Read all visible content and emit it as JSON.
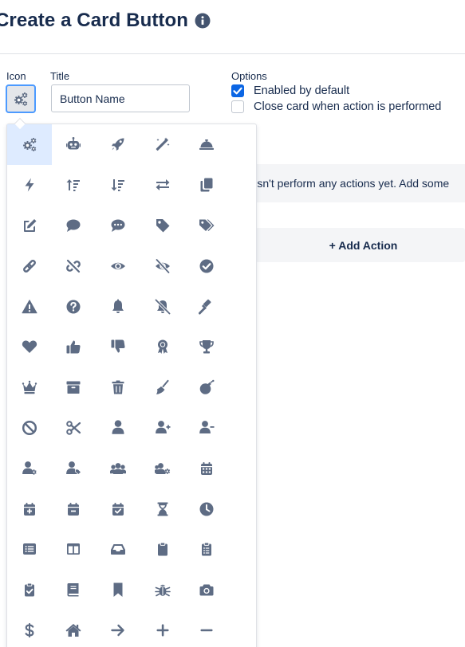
{
  "header": {
    "title": "Create a Card Button",
    "info_icon": "info-circle-icon"
  },
  "form": {
    "icon_label": "Icon",
    "title_label": "Title",
    "title_value": "Button Name",
    "options_label": "Options",
    "options": [
      {
        "label": "Enabled by default",
        "checked": true
      },
      {
        "label": "Close card when action is performed",
        "checked": false
      }
    ]
  },
  "actions": {
    "empty_text": "doesn't perform any actions yet. Add some",
    "add_label": "+ Add Action"
  },
  "icon_picker": {
    "selected": "cogs",
    "icons": [
      "cogs",
      "robot",
      "rocket",
      "magic",
      "concierge-bell",
      "bolt",
      "sort-amount-up",
      "sort-amount-down",
      "exchange",
      "copy",
      "edit",
      "comment",
      "commenting",
      "tag",
      "tags",
      "link",
      "unlink",
      "eye",
      "eye-slash",
      "check-circle",
      "exclamation-triangle",
      "question-circle",
      "bell",
      "bell-slash",
      "gavel",
      "heart",
      "thumbs-up",
      "thumbs-down",
      "award",
      "trophy",
      "crown",
      "archive",
      "trash",
      "broom",
      "bomb",
      "ban",
      "cut",
      "user",
      "user-plus",
      "user-minus",
      "user-cog",
      "user-tag",
      "users",
      "users-cog",
      "calendar",
      "calendar-plus",
      "calendar-minus",
      "calendar-check",
      "hourglass",
      "clock",
      "list-alt",
      "columns",
      "inbox",
      "clipboard",
      "clipboard-list",
      "clipboard-check",
      "book",
      "bookmark",
      "bug",
      "camera",
      "dollar-sign",
      "home",
      "arrow-right",
      "plus",
      "minus"
    ]
  },
  "colors": {
    "icon": "#5e6c84",
    "accent": "#0c66e4",
    "focus": "#4c9aff",
    "text": "#172b4d"
  }
}
